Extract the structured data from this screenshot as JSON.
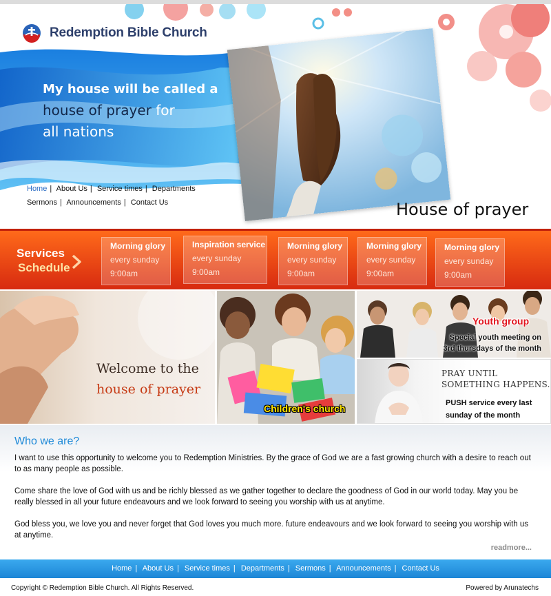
{
  "brand": {
    "name": "Redemption Bible Church"
  },
  "hero": {
    "tagline_line1": "My house will be called a",
    "tagline_highlight": "house of prayer",
    "tagline_for": " for",
    "tagline_line3": "all nations",
    "caption": "House of prayer"
  },
  "nav": {
    "items": [
      "Home",
      "About Us",
      "Service times",
      "Departments",
      "Sermons",
      "Announcements",
      "Contact Us"
    ],
    "active": "Home"
  },
  "services": {
    "title_line1": "Services",
    "title_line2": "Schedule",
    "items": [
      {
        "name": "Morning glory",
        "when": "every sunday",
        "time": "9:00am"
      },
      {
        "name": "Inspiration service",
        "when": "every sunday",
        "time": "9:00am"
      },
      {
        "name": "Morning glory",
        "when": "every sunday",
        "time": "9:00am"
      },
      {
        "name": "Morning glory",
        "when": "every sunday",
        "time": "9:00am"
      },
      {
        "name": "Morning glory",
        "when": "every sunday",
        "time": "9:00am"
      }
    ]
  },
  "panels": {
    "welcome_line1": "Welcome to the",
    "welcome_line2": "house of prayer",
    "children_label": "Children's church",
    "youth_title": "Youth group",
    "youth_desc_line1": "Special youth meeting on",
    "youth_desc_line2": "3rd thursdays of the month",
    "pray_heading_line1": "PRAY UNTIL",
    "pray_heading_line2": "SOMETHING HAPPENS.",
    "pray_desc_line1": "PUSH service every last",
    "pray_desc_line2": "sunday of the month"
  },
  "about": {
    "title": "Who we are?",
    "paragraphs": [
      "I want to use this opportunity to welcome you to Redemption Ministries. By the grace of God we are a fast growing church with a desire to reach out to as many people as possible.",
      "Come share the love of God with us and be richly blessed as we gather together to declare the goodness of God in our world today. May you be really blessed in all your future endeavours and we look forward to seeing you worship with us at anytime.",
      "God bless you, we love you and never forget that God loves you much more. future endeavours and we look forward to seeing you worship with us at anytime."
    ],
    "readmore": "readmore..."
  },
  "footer": {
    "nav": [
      "Home",
      "About Us",
      "Service times",
      "Departments",
      "Sermons",
      "Announcements",
      "Contact Us"
    ],
    "copyright": "Copyright © Redemption Bible Church. All Rights Reserved.",
    "powered": "Powered by Arunatechs"
  },
  "colors": {
    "accent_blue": "#1f8ad8",
    "services_orange": "#e84a14",
    "footer_blue": "#2a97e3",
    "brand_navy": "#2d3f6b"
  }
}
